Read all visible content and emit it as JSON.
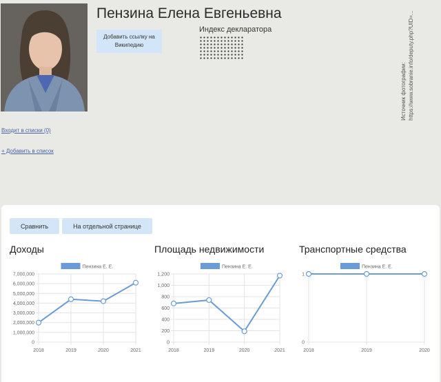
{
  "profile": {
    "name": "Пензина Елена Евгеньевна",
    "wiki_button_label": "Добавить ссылку на Википедию",
    "declarant_index_label": "Индекс декларатора",
    "photo_source_label": "Источник фотографии:",
    "photo_source_url": "https://www.sobranie.info/deputy.php?UID=..."
  },
  "links": {
    "lists_label": "Входит в списки (0)",
    "add_to_list_label": "+ Добавить в список"
  },
  "toolbar": {
    "compare_label": "Сравнить",
    "separate_page_label": "На отдельной странице"
  },
  "colors": {
    "accent": "#d3e6f7",
    "series": "#6b9bd6",
    "link": "#4a63a8"
  },
  "chart_data": [
    {
      "type": "line",
      "title": "Доходы",
      "x": [
        "2018",
        "2019",
        "2020",
        "2021"
      ],
      "series": [
        {
          "name": "Пензина Е. Е.",
          "values": [
            2000000,
            4400000,
            4200000,
            6100000
          ]
        }
      ],
      "yticks": [
        "0",
        "1,000,000",
        "2,000,000",
        "3,000,000",
        "4,000,000",
        "5,000,000",
        "6,000,000",
        "7,000,000"
      ],
      "ylim": [
        0,
        7000000
      ],
      "legend": "top-center",
      "grid": true
    },
    {
      "type": "line",
      "title": "Площадь недвижимости",
      "x": [
        "2018",
        "2019",
        "2020",
        "2021"
      ],
      "series": [
        {
          "name": "Пензина Е. Е.",
          "values": [
            680,
            740,
            190,
            1170
          ]
        }
      ],
      "yticks": [
        "0",
        "200",
        "400",
        "600",
        "800",
        "1,000",
        "1,200"
      ],
      "ylim": [
        0,
        1200
      ],
      "legend": "top-center",
      "grid": true
    },
    {
      "type": "line",
      "title": "Транспортные средства",
      "x": [
        "2018",
        "2019",
        "2020"
      ],
      "series": [
        {
          "name": "Пензина Е. Е.",
          "values": [
            1,
            1,
            1
          ]
        }
      ],
      "yticks": [
        "0",
        "1"
      ],
      "ylim": [
        0,
        1
      ],
      "legend": "top-center",
      "grid": true
    }
  ]
}
